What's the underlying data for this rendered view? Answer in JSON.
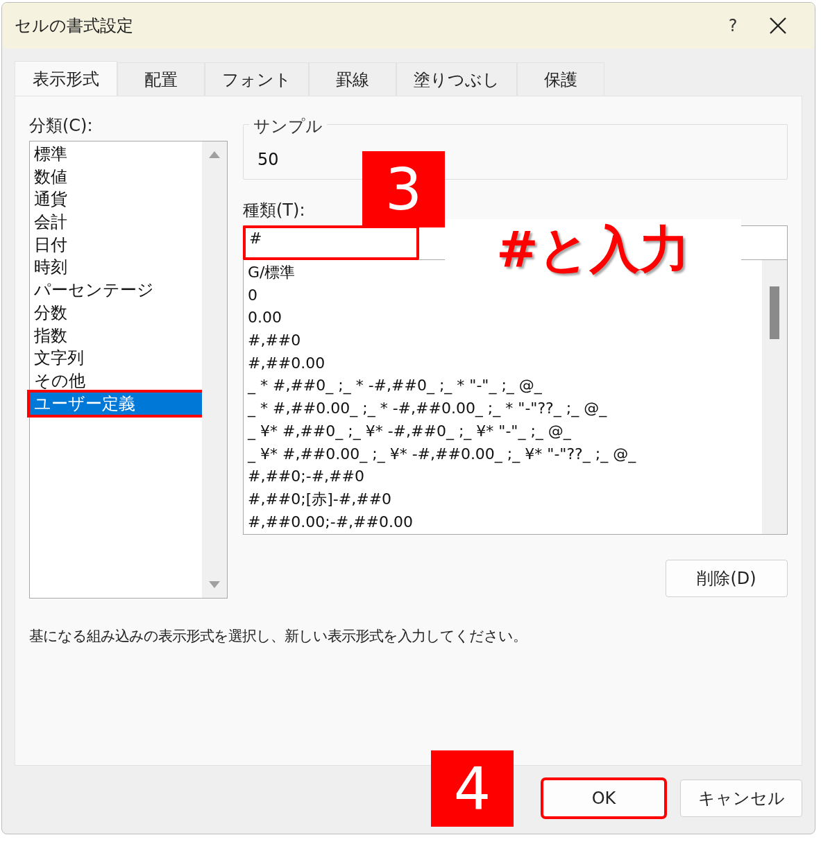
{
  "window": {
    "title": "セルの書式設定",
    "help": "?"
  },
  "tabs": [
    {
      "label": "表示形式",
      "selected": true
    },
    {
      "label": "配置",
      "selected": false
    },
    {
      "label": "フォント",
      "selected": false
    },
    {
      "label": "罫線",
      "selected": false
    },
    {
      "label": "塗りつぶし",
      "selected": false
    },
    {
      "label": "保護",
      "selected": false
    }
  ],
  "category": {
    "label": "分類(C):",
    "items": [
      {
        "label": "標準",
        "selected": false
      },
      {
        "label": "数値",
        "selected": false
      },
      {
        "label": "通貨",
        "selected": false
      },
      {
        "label": "会計",
        "selected": false
      },
      {
        "label": "日付",
        "selected": false
      },
      {
        "label": "時刻",
        "selected": false
      },
      {
        "label": "パーセンテージ",
        "selected": false
      },
      {
        "label": "分数",
        "selected": false
      },
      {
        "label": "指数",
        "selected": false
      },
      {
        "label": "文字列",
        "selected": false
      },
      {
        "label": "その他",
        "selected": false
      },
      {
        "label": "ユーザー定義",
        "selected": true
      }
    ]
  },
  "sample": {
    "legend": "サンプル",
    "value": "50"
  },
  "type": {
    "label": "種類(T):",
    "value": "#",
    "formats": [
      "G/標準",
      "0",
      "0.00",
      "#,##0",
      "#,##0.00",
      "_ * #,##0_ ;_ * -#,##0_ ;_ * \"-\"_ ;_ @_",
      "_ * #,##0.00_ ;_ * -#,##0.00_ ;_ * \"-\"??_ ;_ @_",
      "_ ¥* #,##0_ ;_ ¥* -#,##0_ ;_ ¥* \"-\"_ ;_ @_",
      "_ ¥* #,##0.00_ ;_ ¥* -#,##0.00_ ;_ ¥* \"-\"??_ ;_ @_",
      "#,##0;-#,##0",
      "#,##0;[赤]-#,##0",
      "#,##0.00;-#,##0.00"
    ]
  },
  "delete_button": "削除(D)",
  "description": "基になる組み込みの表示形式を選択し、新しい表示形式を入力してください。",
  "buttons": [
    {
      "label": "OK",
      "highlighted": true
    },
    {
      "label": "キャンセル",
      "highlighted": false
    }
  ],
  "annotations": [
    {
      "kind": "step",
      "text": "3"
    },
    {
      "kind": "callout",
      "text": "#と入力"
    },
    {
      "kind": "step",
      "text": "4"
    }
  ]
}
